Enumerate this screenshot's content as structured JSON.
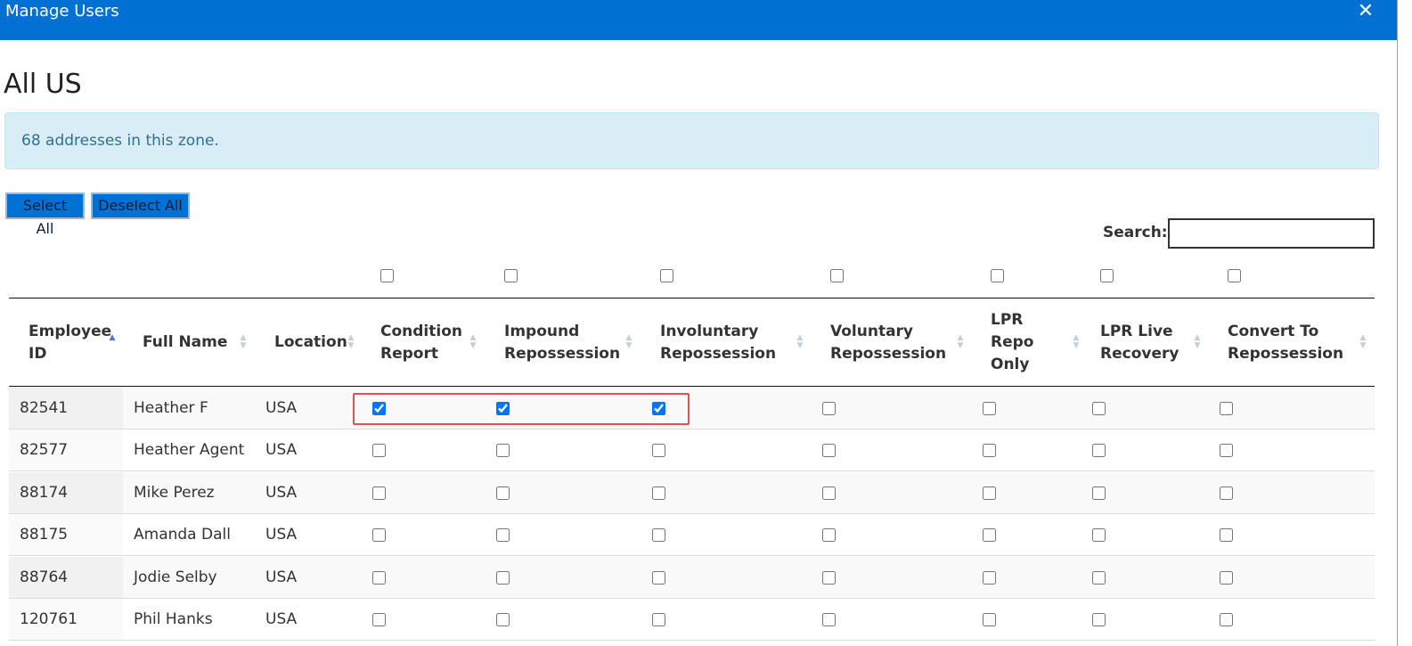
{
  "window": {
    "title": "Manage Users",
    "close_icon": "close-icon"
  },
  "zone": {
    "title": "All US",
    "info": "68 addresses in this zone."
  },
  "buttons": {
    "select_all": "Select All",
    "deselect_all": "Deselect All"
  },
  "search": {
    "label": "Search:",
    "value": ""
  },
  "columns": [
    {
      "label": "Employee ID",
      "sort": "asc"
    },
    {
      "label": "Full Name",
      "sort": "none"
    },
    {
      "label": "Location",
      "sort": "none"
    },
    {
      "label": "Condition Report",
      "sort": "none"
    },
    {
      "label": "Impound Repossession",
      "sort": "none"
    },
    {
      "label": "Involuntary Repossession",
      "sort": "none"
    },
    {
      "label": "Voluntary Repossession",
      "sort": "none"
    },
    {
      "label": "LPR Repo Only",
      "sort": "none"
    },
    {
      "label": "LPR Live Recovery",
      "sort": "none"
    },
    {
      "label": "Convert To Repossession",
      "sort": "none"
    }
  ],
  "header_checkboxes": [
    false,
    false,
    false,
    false,
    false,
    false,
    false
  ],
  "rows": [
    {
      "id": "82541",
      "name": "Heather F",
      "location": "USA",
      "checks": [
        true,
        true,
        true,
        false,
        false,
        false,
        false
      ]
    },
    {
      "id": "82577",
      "name": "Heather Agent",
      "location": "USA",
      "checks": [
        false,
        false,
        false,
        false,
        false,
        false,
        false
      ]
    },
    {
      "id": "88174",
      "name": "Mike Perez",
      "location": "USA",
      "checks": [
        false,
        false,
        false,
        false,
        false,
        false,
        false
      ]
    },
    {
      "id": "88175",
      "name": "Amanda Dall",
      "location": "USA",
      "checks": [
        false,
        false,
        false,
        false,
        false,
        false,
        false
      ]
    },
    {
      "id": "88764",
      "name": "Jodie Selby",
      "location": "USA",
      "checks": [
        false,
        false,
        false,
        false,
        false,
        false,
        false
      ]
    },
    {
      "id": "120761",
      "name": "Phil Hanks",
      "location": "USA",
      "checks": [
        false,
        false,
        false,
        false,
        false,
        false,
        false
      ]
    }
  ],
  "colors": {
    "accent": "#0070d2",
    "alert_bg": "#d9edf7",
    "alert_text": "#31708f",
    "highlight": "#e05252"
  }
}
